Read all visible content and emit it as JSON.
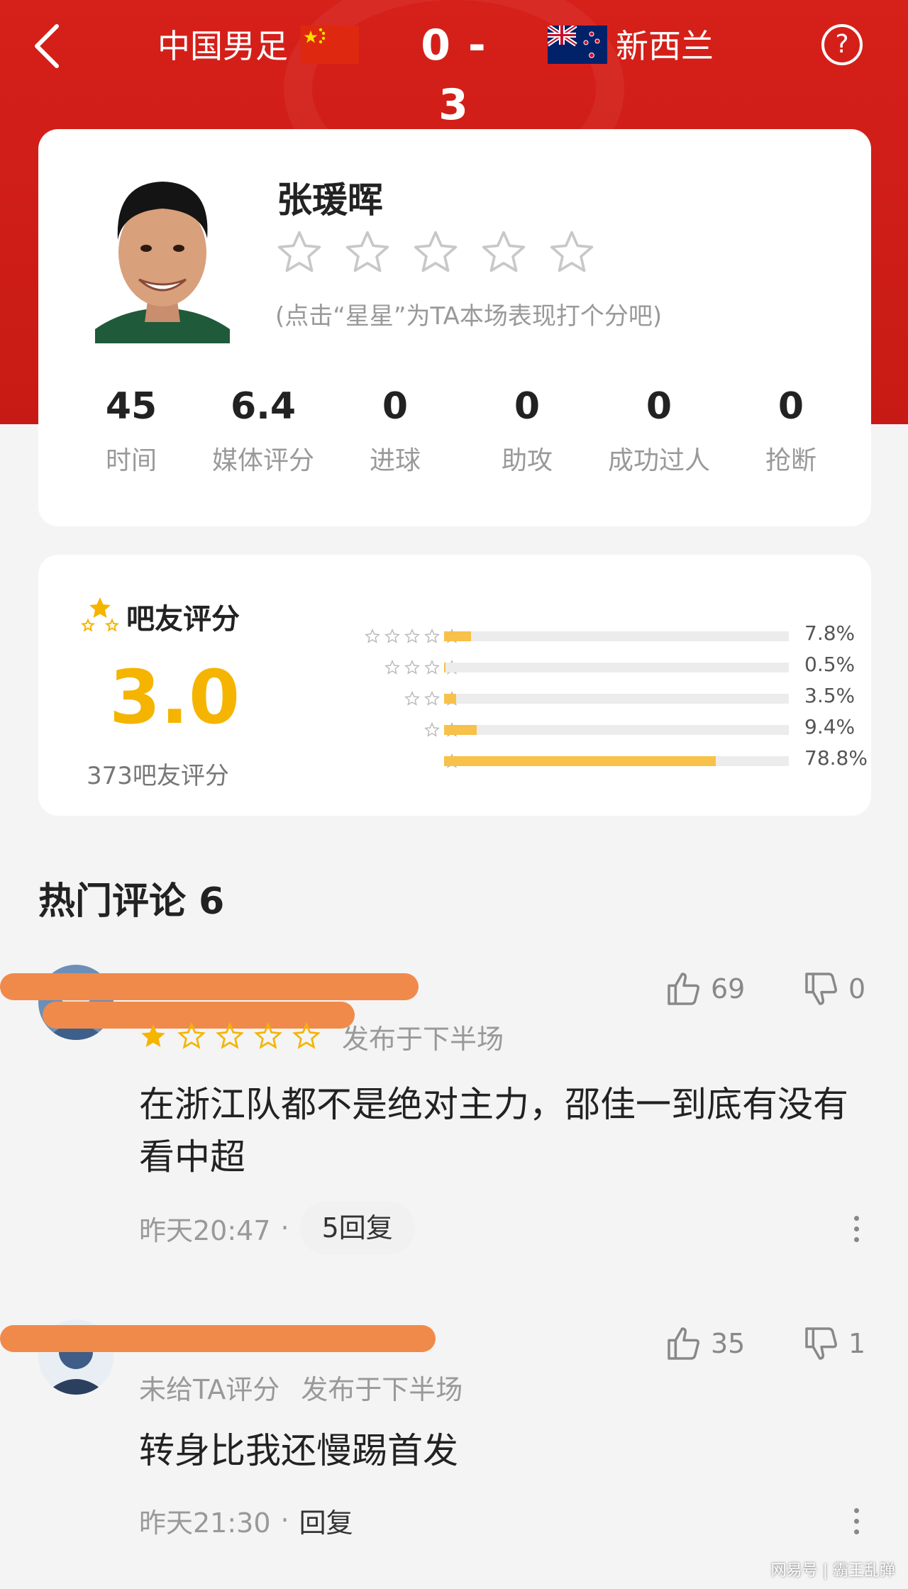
{
  "header": {
    "home_team": "中国男足",
    "score": "0 - 3",
    "away_team": "新西兰",
    "help": "?"
  },
  "player": {
    "name": "张瑗晖",
    "rate_hint": "(点击“星星”为TA本场表现打个分吧)",
    "user_rating": 0,
    "stats": [
      {
        "value": "45",
        "label": "时间"
      },
      {
        "value": "6.4",
        "label": "媒体评分"
      },
      {
        "value": "0",
        "label": "进球"
      },
      {
        "value": "0",
        "label": "助攻"
      },
      {
        "value": "0",
        "label": "成功过人"
      },
      {
        "value": "0",
        "label": "抢断"
      }
    ]
  },
  "fan_rating": {
    "title": "吧友评分",
    "score": "3.0",
    "count": "373吧友评分",
    "distribution": [
      {
        "stars": 5,
        "percent": 7.8,
        "label": "7.8%"
      },
      {
        "stars": 4,
        "percent": 0.5,
        "label": "0.5%"
      },
      {
        "stars": 3,
        "percent": 3.5,
        "label": "3.5%"
      },
      {
        "stars": 2,
        "percent": 9.4,
        "label": "9.4%"
      },
      {
        "stars": 1,
        "percent": 78.8,
        "label": "78.8%"
      }
    ]
  },
  "comments_section": {
    "title": "热门评论 6"
  },
  "comments": [
    {
      "rating": 1,
      "posted_when": "发布于下半场",
      "likes": "69",
      "dislikes": "0",
      "body": "在浙江队都不是绝对主力，邵佳一到底有没有看中超",
      "time": "昨天20:47",
      "replies": "5回复"
    },
    {
      "rating_text": "未给TA评分",
      "posted_when": "发布于下半场",
      "likes": "35",
      "dislikes": "1",
      "body": "转身比我还慢踢首发",
      "time": "昨天21:30",
      "replies": "回复"
    }
  ],
  "watermark": "网易号 | 霸王乱弹",
  "colors": {
    "header_red": "#d6201a",
    "accent_gold": "#f5b400",
    "bar_fill": "#f7c14a"
  }
}
